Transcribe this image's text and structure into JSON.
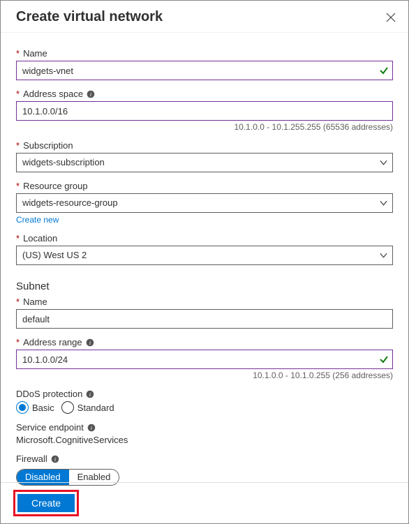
{
  "header": {
    "title": "Create virtual network"
  },
  "labels": {
    "name": "Name",
    "address_space": "Address space",
    "subscription": "Subscription",
    "resource_group": "Resource group",
    "create_new": "Create new",
    "location": "Location",
    "subnet_heading": "Subnet",
    "subnet_name": "Name",
    "address_range": "Address range",
    "ddos": "DDoS protection",
    "basic": "Basic",
    "standard": "Standard",
    "service_endpoint": "Service endpoint",
    "firewall": "Firewall",
    "disabled": "Disabled",
    "enabled": "Enabled"
  },
  "values": {
    "name": "widgets-vnet",
    "address_space": "10.1.0.0/16",
    "address_space_hint": "10.1.0.0 - 10.1.255.255 (65536 addresses)",
    "subscription": "widgets-subscription",
    "resource_group": "widgets-resource-group",
    "location": "(US) West US 2",
    "subnet_name": "default",
    "address_range": "10.1.0.0/24",
    "address_range_hint": "10.1.0.0 - 10.1.0.255 (256 addresses)",
    "service_endpoint_value": "Microsoft.CognitiveServices"
  },
  "footer": {
    "create": "Create"
  }
}
